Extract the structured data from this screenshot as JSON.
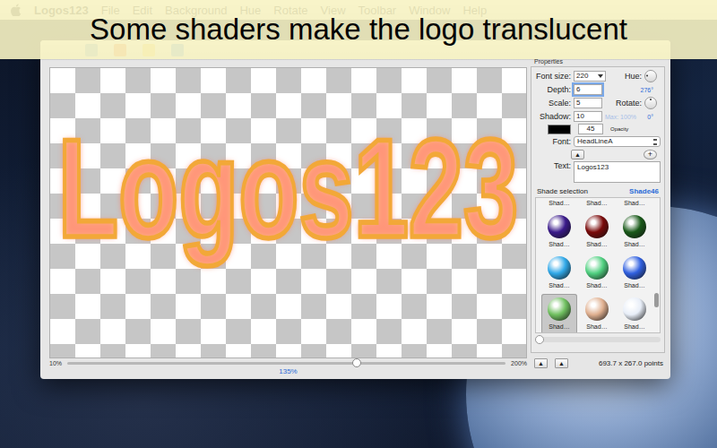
{
  "banner": "Some shaders make the logo translucent",
  "menu_bar": {
    "app": "Logos123",
    "items": [
      "File",
      "Edit",
      "Background",
      "Hue",
      "Rotate",
      "View",
      "Toolbar",
      "Window",
      "Help"
    ]
  },
  "canvas": {
    "logo_text": "Logos123"
  },
  "zoom": {
    "min": "10%",
    "max": "200%",
    "reading": "135%",
    "level": 0.66
  },
  "properties": {
    "title": "Properties",
    "font_size": {
      "label": "Font size:",
      "value": "220"
    },
    "hue": {
      "label": "Hue:",
      "reading": "276°",
      "level": 0.77
    },
    "depth": {
      "label": "Depth:",
      "value": "6",
      "focused": true
    },
    "scale": {
      "label": "Scale:",
      "value": "5",
      "focused": false
    },
    "rotate": {
      "label": "Rotate:",
      "reading": "0°",
      "level": 0
    },
    "shadow": {
      "label": "Shadow:",
      "value": "10",
      "hint": "Max: 100%"
    },
    "color": {
      "swatch": "#000000",
      "value": "45",
      "label": "Opacity"
    },
    "font": {
      "label": "Font:",
      "value": "HeadLineA"
    },
    "buttons": [
      "▲",
      "+"
    ],
    "text": {
      "label": "Text:",
      "value": "Logos123"
    }
  },
  "shaders": {
    "title": "Shade selection",
    "current": "Shade46",
    "scroll_level": 0.8,
    "h_scroll_level": 0,
    "items": [
      {
        "label": "Shad…",
        "selected": false,
        "color": "#8a8a9a"
      },
      {
        "label": "Shad…",
        "selected": false,
        "color": "#a07050"
      },
      {
        "label": "Shad…",
        "selected": false,
        "color": "#6a8aa0"
      },
      {
        "label": "Shad…",
        "selected": false,
        "color": "#3a1a8a"
      },
      {
        "label": "Shad…",
        "selected": false,
        "color": "#7a0a0a"
      },
      {
        "label": "Shad…",
        "selected": false,
        "color": "#1a5a1a"
      },
      {
        "label": "Shad…",
        "selected": false,
        "color": "#30a8e8"
      },
      {
        "label": "Shad…",
        "selected": false,
        "color": "#50d080"
      },
      {
        "label": "Shad…",
        "selected": false,
        "color": "#3060e0"
      },
      {
        "label": "Shad…",
        "selected": true,
        "color": "#70c060"
      },
      {
        "label": "Shad…",
        "selected": false,
        "color": "#e0b090"
      },
      {
        "label": "Shad…",
        "selected": false,
        "color": "#e8eef8"
      }
    ]
  },
  "bottom_buttons": [
    "▲",
    "▲"
  ],
  "status": "693.7 x 267.0 points"
}
